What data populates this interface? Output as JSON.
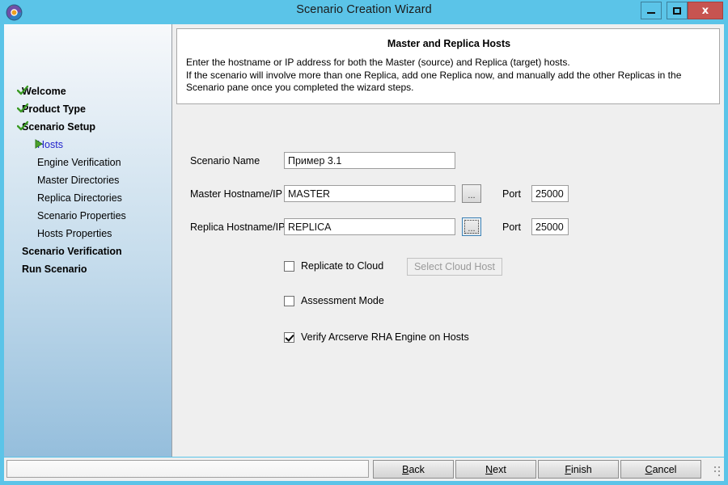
{
  "window": {
    "title": "Scenario Creation Wizard",
    "app_icon": "arcserve-logo-icon",
    "frame_color": "#5bc4e8",
    "controls": {
      "minimize": "minimize-icon",
      "maximize": "maximize-icon",
      "close_label": "x",
      "close_color": "#c75450"
    }
  },
  "sidebar": {
    "items": [
      {
        "label": "Welcome",
        "level": 0,
        "state": "done",
        "icon": "green-check-icon"
      },
      {
        "label": "Product Type",
        "level": 0,
        "state": "done",
        "icon": "green-check-icon"
      },
      {
        "label": "Scenario Setup",
        "level": 0,
        "state": "done",
        "icon": "green-check-icon"
      },
      {
        "label": "Hosts",
        "level": 1,
        "state": "current",
        "icon": "green-arrow-icon"
      },
      {
        "label": "Engine Verification",
        "level": 1,
        "state": "pending",
        "icon": ""
      },
      {
        "label": "Master Directories",
        "level": 1,
        "state": "pending",
        "icon": ""
      },
      {
        "label": "Replica Directories",
        "level": 1,
        "state": "pending",
        "icon": ""
      },
      {
        "label": "Scenario Properties",
        "level": 1,
        "state": "pending",
        "icon": ""
      },
      {
        "label": "Hosts Properties",
        "level": 1,
        "state": "pending",
        "icon": ""
      },
      {
        "label": "Scenario Verification",
        "level": 0,
        "state": "pending",
        "icon": ""
      },
      {
        "label": "Run Scenario",
        "level": 0,
        "state": "pending",
        "icon": ""
      }
    ],
    "current_color": "#2222cc",
    "check_color": "#3a9a23"
  },
  "header": {
    "title": "Master and Replica Hosts",
    "line1": "Enter the hostname or IP address for both the Master (source) and Replica (target) hosts.",
    "line2": "If the scenario will involve more than one Replica, add one Replica now, and manually add the other Replicas in the Scenario pane once you completed the wizard steps."
  },
  "form": {
    "scenario_name": {
      "label": "Scenario Name",
      "value": "Пример 3.1",
      "placeholder": ""
    },
    "master": {
      "label": "Master Hostname/IP",
      "value": "MASTER",
      "placeholder": "",
      "browse_label": "...",
      "port_label": "Port",
      "port_value": "25000"
    },
    "replica": {
      "label": "Replica Hostname/IP",
      "value": "REPLICA",
      "placeholder": "",
      "browse_label": "...",
      "browse_focused": true,
      "port_label": "Port",
      "port_value": "25000"
    },
    "replicate_to_cloud": {
      "label": "Replicate to Cloud",
      "checked": false
    },
    "select_cloud_host": {
      "label": "Select Cloud Host",
      "enabled": false
    },
    "assessment_mode": {
      "label": "Assessment Mode",
      "checked": false
    },
    "verify_engine": {
      "label": "Verify Arcserve RHA Engine on Hosts",
      "checked": true
    }
  },
  "statusbar": {
    "text": ""
  },
  "buttons": {
    "back": {
      "pre": "B",
      "post": "ack"
    },
    "next": {
      "pre": "N",
      "post": "ext"
    },
    "finish": {
      "pre": "F",
      "post": "inish"
    },
    "cancel": {
      "pre": "C",
      "post": "ancel"
    },
    "grip": "resize-grip-icon"
  }
}
